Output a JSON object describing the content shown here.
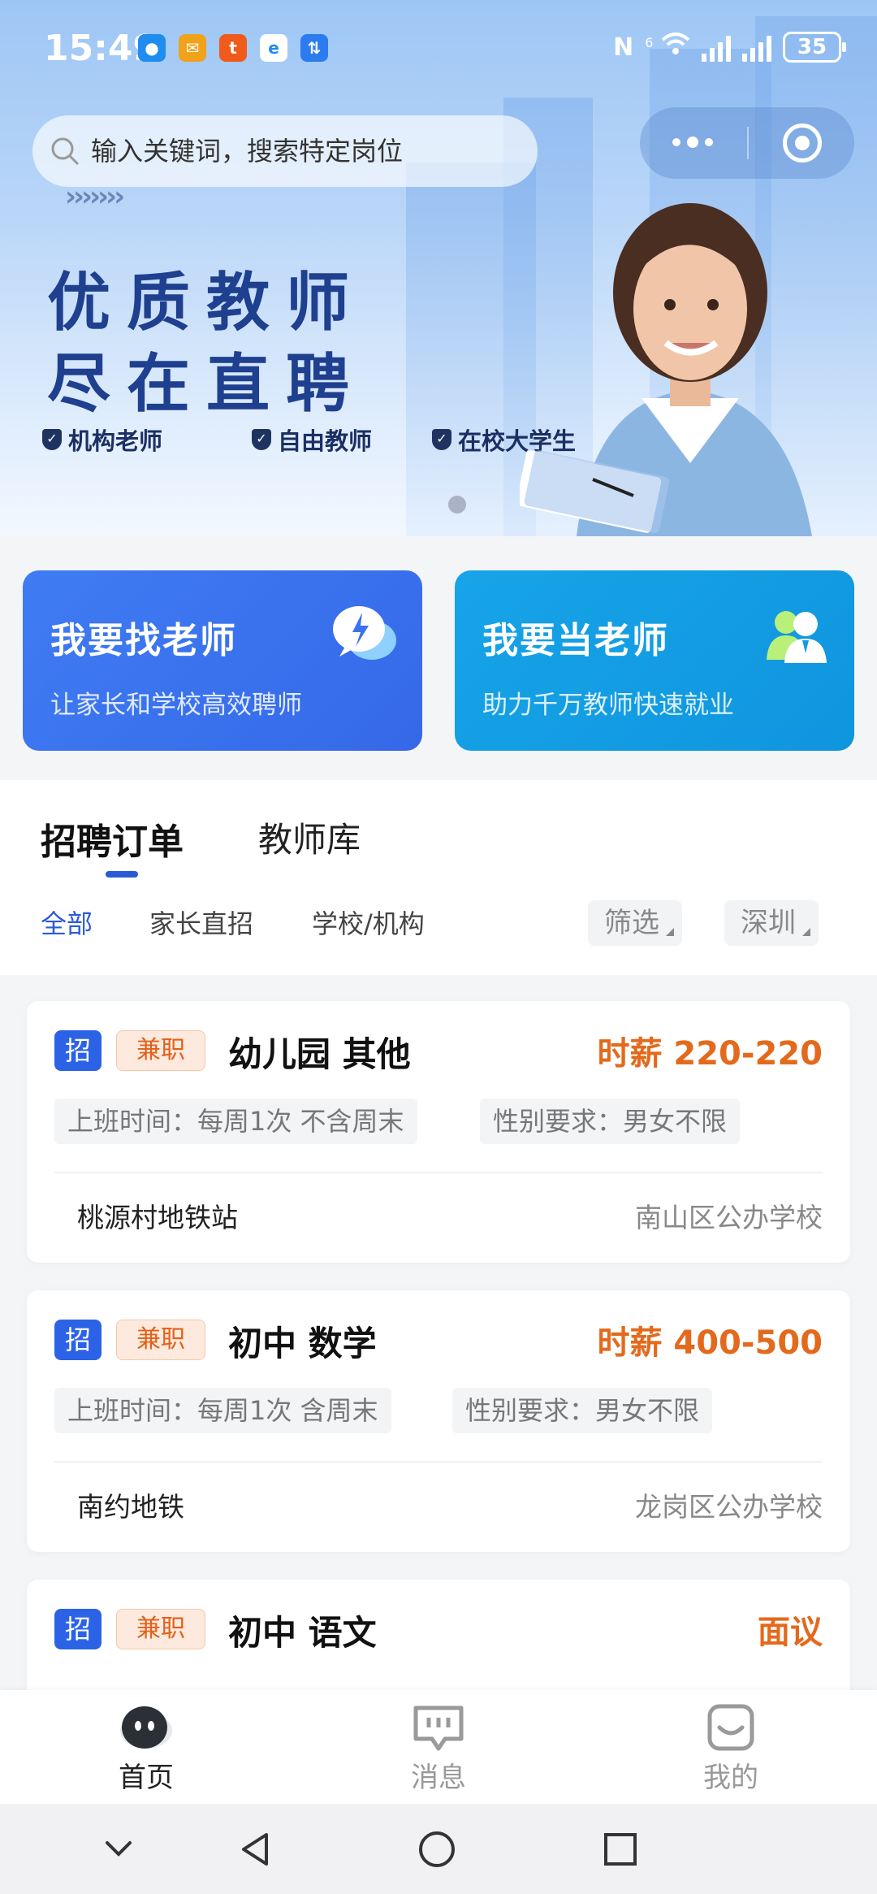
{
  "status_bar": {
    "time": "15:49",
    "battery": "35",
    "network_label": "6",
    "notification_icons": [
      "message-icon",
      "mail-icon",
      "taobao-icon",
      "browser-icon",
      "app-icon"
    ]
  },
  "search": {
    "placeholder": "输入关键词，搜索特定岗位"
  },
  "banner": {
    "headline_line1": "优质教师",
    "headline_line2": "尽在直聘",
    "tags": [
      "机构老师",
      "自由教师",
      "在校大学生"
    ]
  },
  "actions": [
    {
      "title": "我要找老师",
      "subtitle": "让家长和学校高效聘师"
    },
    {
      "title": "我要当老师",
      "subtitle": "助力千万教师快速就业"
    }
  ],
  "tabs": {
    "main": [
      "招聘订单",
      "教师库"
    ],
    "sub": [
      "全部",
      "家长直招",
      "学校/机构"
    ],
    "filter": "筛选",
    "city": "深圳"
  },
  "jobs": [
    {
      "badge": "招",
      "type": "兼职",
      "title": "幼儿园 其他",
      "salary": "时薪 220-220",
      "schedule": "上班时间：每周1次 不含周末",
      "gender": "性别要求：男女不限",
      "location": "桃源村地铁站",
      "school": "南山区公办学校"
    },
    {
      "badge": "招",
      "type": "兼职",
      "title": "初中 数学",
      "salary": "时薪 400-500",
      "schedule": "上班时间：每周1次 含周末",
      "gender": "性别要求：男女不限",
      "location": "南约地铁",
      "school": "龙岗区公办学校"
    },
    {
      "badge": "招",
      "type": "兼职",
      "title": "初中 语文",
      "salary": "面议",
      "schedule": "",
      "gender": "",
      "location": "",
      "school": ""
    }
  ],
  "bottom_nav": [
    {
      "label": "首页",
      "icon": "home-icon"
    },
    {
      "label": "消息",
      "icon": "message-icon"
    },
    {
      "label": "我的",
      "icon": "profile-icon"
    }
  ],
  "colors": {
    "primary": "#2a5bd7",
    "card_find": "#3b72f0",
    "card_be": "#139ce3",
    "salary": "#e36a1c"
  }
}
